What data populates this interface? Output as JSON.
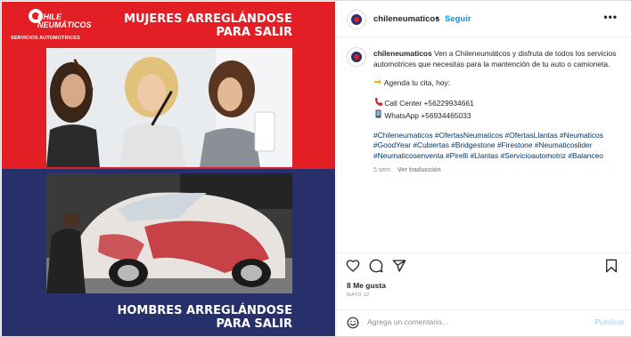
{
  "image": {
    "brand_name_1": "CHILE",
    "brand_name_2": "NEUMÁTICOS",
    "brand_sub": "SERVICIOS AUTOMOTRICES",
    "headline_top_1": "MUJERES ARREGLÁNDOSE",
    "headline_top_2": "PARA SALIR",
    "headline_bottom_1": "HOMBRES ARREGLÁNDOSE",
    "headline_bottom_2": "PARA SALIR",
    "colors": {
      "red": "#e31e24",
      "navy": "#27306b"
    }
  },
  "header": {
    "username": "chileneumaticos",
    "separator": "•",
    "follow_label": "Seguir",
    "more_label": "•••"
  },
  "caption": {
    "username": "chileneumaticos",
    "text": "Ven a Chileneumáticos y disfruta de todos los servicios automotrices que necesitas para la mantención de tu auto o camioneta.",
    "agenda": "Agenda tu cita, hoy:",
    "call_center": "Call Center +56229934661",
    "whatsapp": "WhatsApp +56934465033",
    "hashtags": "#Chileneumaticos #OfertasNeumaticos #OfertasLlantas #Neumaticos #GoodYear #Cubiertas #Bridgestone #Firestone #Neumaticoslider #Neumaticosenventa #Pirelli #Llantas #Servicioautomotriz #Balanceo",
    "time_ago": "5 sem",
    "translate_label": "Ver traducción"
  },
  "actions": {
    "icons": [
      "heart-icon",
      "comment-icon",
      "share-icon",
      "bookmark-icon"
    ],
    "likes": "8 Me gusta",
    "date": "MAYO 12"
  },
  "comment": {
    "placeholder": "Agrega un comentario...",
    "publish_label": "Publicar"
  },
  "colors": {
    "link_blue": "#0095f6",
    "hashtag_blue": "#00376b",
    "muted": "#8e8e8e",
    "publish_disabled": "#b3dbff"
  }
}
